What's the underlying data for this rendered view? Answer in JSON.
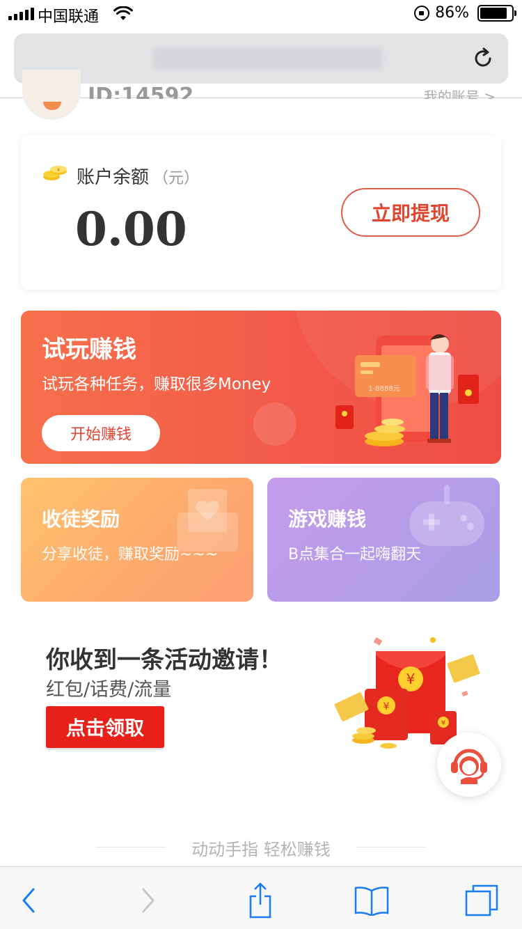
{
  "status_bar": {
    "carrier": "中国联通",
    "battery_percent": "86%",
    "battery_level": 0.86
  },
  "header": {
    "user_id": "ID:14592",
    "right_text": "我的账号 >"
  },
  "balance": {
    "label": "账户余额",
    "unit": "（元）",
    "amount": "0.00",
    "withdraw_label": "立即提现"
  },
  "trial": {
    "title": "试玩赚钱",
    "subtitle": "试玩各种任务，赚取很多Money",
    "button_label": "开始赚钱",
    "card_text": "1-8888元"
  },
  "cards": [
    {
      "title": "收徒奖励",
      "subtitle": "分享收徒，赚取奖励~~~"
    },
    {
      "title": "游戏赚钱",
      "subtitle": "B点集合一起嗨翻天"
    }
  ],
  "invite": {
    "title": "你收到一条活动邀请！",
    "subtitle": "红包/话费/流量",
    "button_label": "点击领取"
  },
  "footer": {
    "slogan": "动动手指 轻松赚钱"
  },
  "colors": {
    "accent_red": "#e8201a",
    "trial_gradient_start": "#f6704b",
    "trial_gradient_end": "#ef4d44",
    "disciple_gradient_start": "#ffc36e",
    "game_gradient_start": "#c49bea",
    "safari_blue": "#1a7cf5"
  },
  "icons": {
    "toolbar": [
      "back-icon",
      "forward-icon",
      "share-icon",
      "bookmarks-icon",
      "tabs-icon"
    ]
  }
}
